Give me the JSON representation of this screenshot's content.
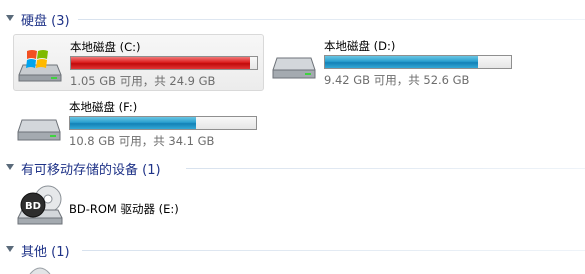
{
  "sections": {
    "hard_disks": {
      "title": "硬盘 (3)"
    },
    "removable": {
      "title": "有可移动存储的设备 (1)"
    },
    "other": {
      "title": "其他 (1)"
    }
  },
  "drives": {
    "c": {
      "name": "本地磁盘 (C:)",
      "space": "1.05 GB 可用，共 24.9 GB",
      "used_fraction": 0.96,
      "bar_color": "#cc1414"
    },
    "d": {
      "name": "本地磁盘 (D:)",
      "space": "9.42 GB 可用，共 52.6 GB",
      "used_fraction": 0.82,
      "bar_color": "#1c8fc4"
    },
    "f": {
      "name": "本地磁盘 (F:)",
      "space": "10.8 GB 可用，共 34.1 GB",
      "used_fraction": 0.68,
      "bar_color": "#1c8fc4"
    }
  },
  "removable_devices": {
    "e": {
      "name": "BD-ROM 驱动器 (E:)",
      "icon": "bd-rom-icon",
      "disc_label": "BD"
    }
  },
  "icons": {
    "drive": "hard-drive-icon",
    "system_drive": "system-drive-windows-icon"
  }
}
